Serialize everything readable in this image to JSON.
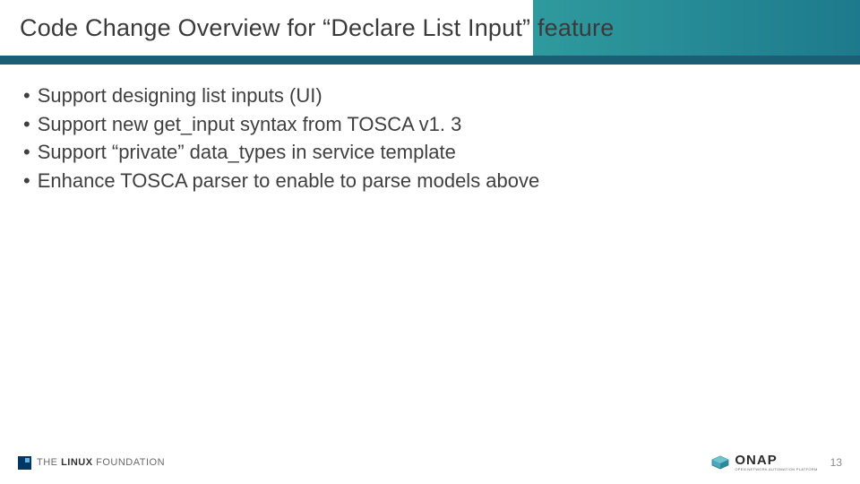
{
  "slide": {
    "title": "Code Change Overview for “Declare List Input” feature",
    "bullets": [
      "Support designing list inputs (UI)",
      "Support new get_input syntax from TOSCA v1. 3",
      "Support “private” data_types in service template",
      "Enhance TOSCA parser to enable to parse models above"
    ]
  },
  "footer": {
    "linux_foundation_prefix": "THE",
    "linux_foundation_main": "LINUX",
    "linux_foundation_suffix": "FOUNDATION",
    "onap_label": "ONAP",
    "onap_tagline": "OPEN NETWORK AUTOMATION PLATFORM",
    "page_number": "13"
  }
}
